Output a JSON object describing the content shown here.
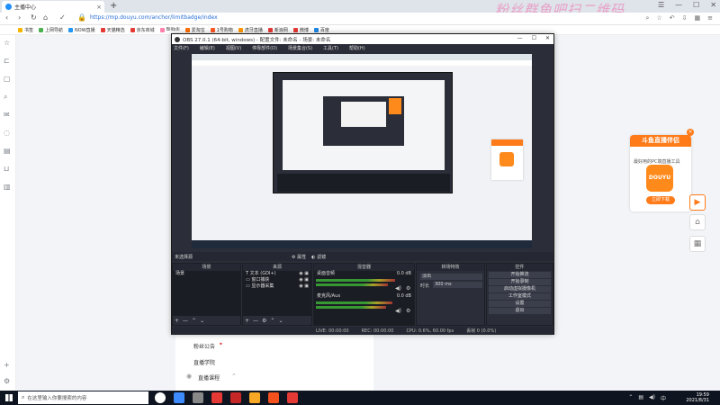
{
  "browser": {
    "tab_title": "主播中心",
    "watermark": "粉丝群鱼吧扫二维码",
    "url": "https://mp.douyu.com/anchor/limitbadge/index",
    "new_tab": "+",
    "bookmarks": [
      {
        "label": "书签",
        "color": "#f4b400"
      },
      {
        "label": "上网导航",
        "color": "#4caf50"
      },
      {
        "label": "NOW直播",
        "color": "#2196f3"
      },
      {
        "label": "天猫精选",
        "color": "#e53935"
      },
      {
        "label": "京东商城",
        "color": "#e53935"
      },
      {
        "label": "Bilibili",
        "color": "#ff80ab"
      },
      {
        "label": "爱淘宝",
        "color": "#ff6f00"
      },
      {
        "label": "1号购物",
        "color": "#ff5722"
      },
      {
        "label": "虎牙直播",
        "color": "#ff9800"
      },
      {
        "label": "新浪网",
        "color": "#e53935"
      },
      {
        "label": "微博",
        "color": "#e53935"
      },
      {
        "label": "百度",
        "color": "#1e88e5"
      }
    ]
  },
  "page": {
    "menu": [
      "粉丝公告",
      "直播学院",
      "直播课程"
    ],
    "badge": "•"
  },
  "promo": {
    "title": "斗鱼直播伴侣",
    "subtitle": "最好用的PC端直播工具",
    "logo": "DOUYU",
    "download": "立即下载",
    "close": "×"
  },
  "obs": {
    "title": "OBS 27.0.1 (64-bit, windows) - 配置文件: 未命名 - 场景: 未命名",
    "menu": [
      "文件(F)",
      "编辑(E)",
      "视图(V)",
      "停靠部件(D)",
      "场景集合(S)",
      "工具(T)",
      "帮助(H)"
    ],
    "scene_bar": "未选择源",
    "scene_bar_buttons": [
      "属性",
      "滤镜"
    ],
    "docks": {
      "scenes": {
        "title": "场景",
        "items": [
          "场景"
        ]
      },
      "sources": {
        "title": "来源",
        "items": [
          "文本 (GDI+)",
          "窗口捕获",
          "显示器采集"
        ]
      },
      "mixer": {
        "title": "混音器",
        "tracks": [
          {
            "name": "桌面音频",
            "db": "0.0 dB"
          },
          {
            "name": "麦克风/Aux",
            "db": "0.0 dB"
          }
        ]
      },
      "transitions": {
        "title": "转场特效",
        "type": "淡出",
        "duration_label": "时长",
        "duration": "300 ms"
      },
      "controls": {
        "title": "控件",
        "buttons": [
          "开始推流",
          "开始录制",
          "启动虚拟摄像机",
          "工作室模式",
          "设置",
          "退出"
        ]
      }
    },
    "status": {
      "live": "LIVE: 00:00:00",
      "rec": "REC: 00:00:00",
      "cpu": "CPU: 0.6%, 60.00 fps",
      "dropped": "丢帧 0 (0.0%)"
    }
  },
  "taskbar": {
    "search_placeholder": "在这里输入你要搜索的内容",
    "time": "19:59",
    "date": "2021/8/31",
    "apps": [
      "#ffffff",
      "#3d8bfd",
      "#888888",
      "#e53935",
      "#c62828",
      "#f9a825",
      "#f4511e",
      "#e53935"
    ]
  }
}
